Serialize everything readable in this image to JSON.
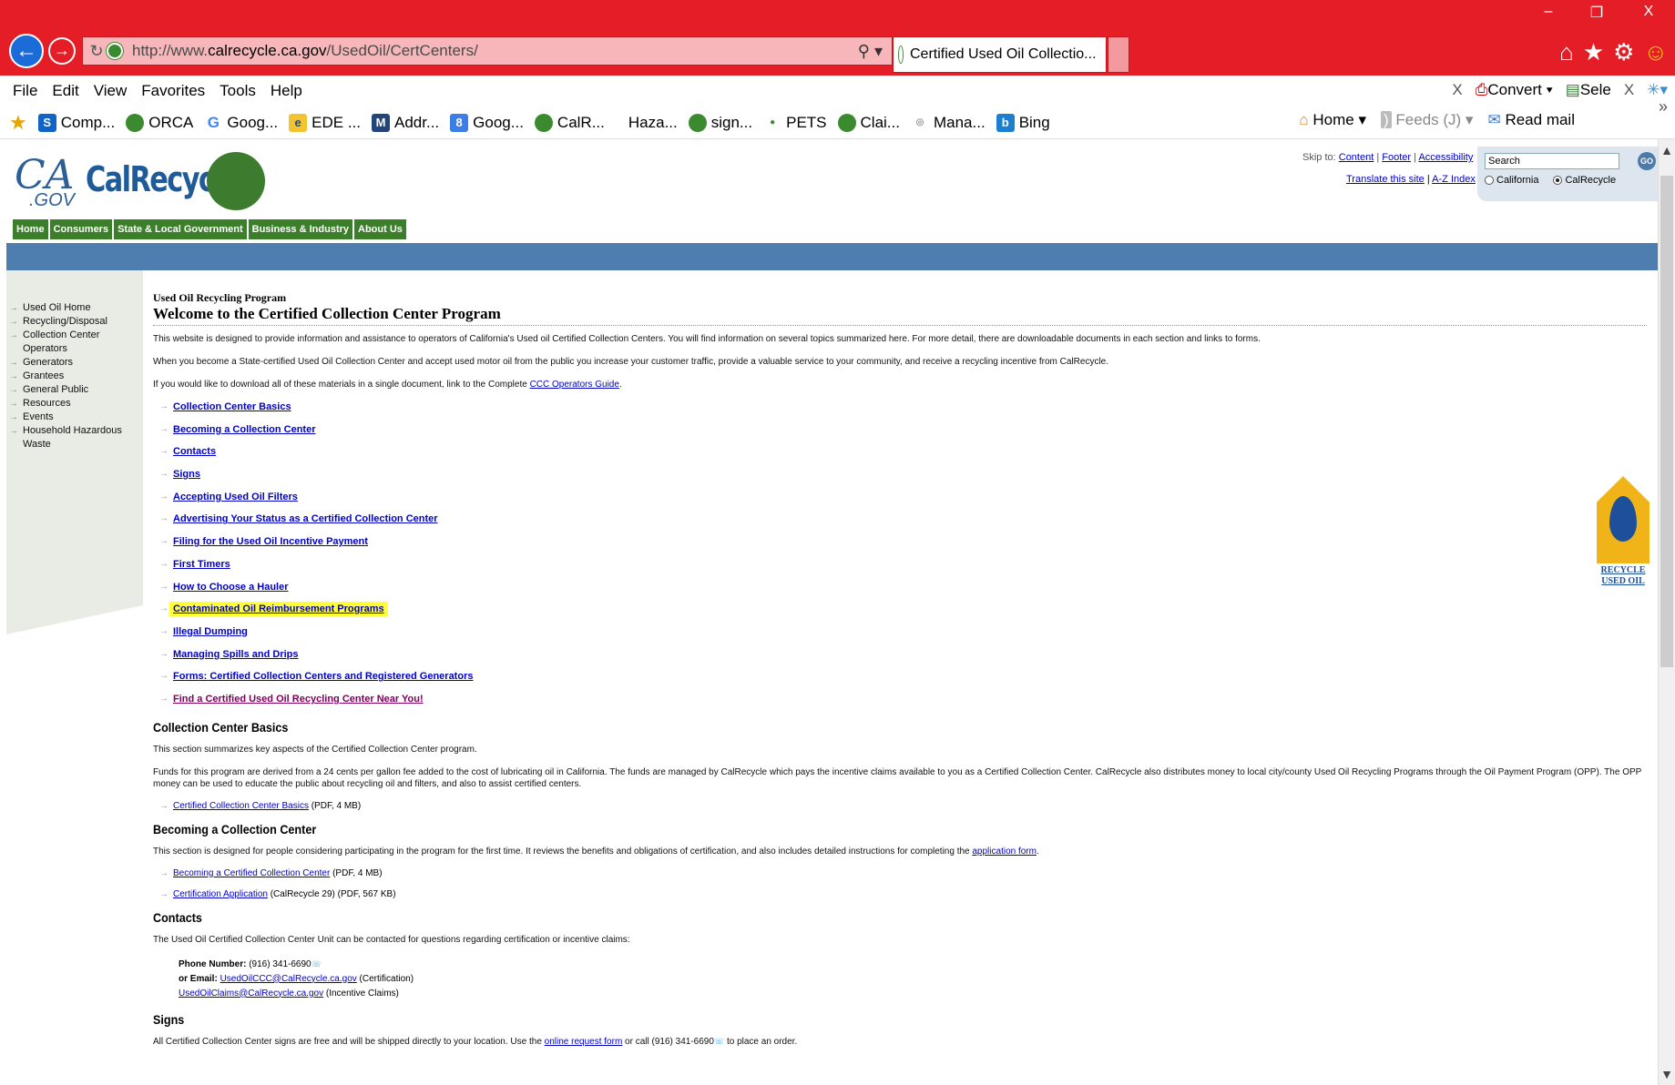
{
  "browser": {
    "window_controls": [
      "–",
      "❐",
      "X"
    ],
    "url_prefix": "http://www.",
    "url_domain": "calrecycle.ca.gov",
    "url_path": "/UsedOil/CertCenters/",
    "tab_title": "Certified Used Oil Collectio...",
    "tab_close": "×",
    "menu": [
      "File",
      "Edit",
      "View",
      "Favorites",
      "Tools",
      "Help"
    ],
    "menu_right": {
      "close": "X",
      "convert": "Convert",
      "select": "Sele",
      "close2": "X"
    },
    "favorites": [
      "Comp...",
      "ORCA",
      "Goog...",
      "EDE ...",
      "Addr...",
      "Goog...",
      "CalR...",
      "Haza...",
      "sign...",
      "PETS",
      "Clai...",
      "Mana...",
      "Bing"
    ],
    "fav_right": {
      "home": "Home",
      "feeds": "Feeds (J)",
      "read_mail": "Read mail"
    }
  },
  "header": {
    "logo_ca": "CA",
    "logo_gov": ".GOV",
    "logo_word": "CalRecycle",
    "topnav": [
      "Home",
      "Consumers",
      "State & Local Government",
      "Business & Industry",
      "About Us"
    ],
    "skip_to": "Skip to:",
    "skip_links": [
      "Content",
      "Footer",
      "Accessibility"
    ],
    "translate": "Translate this site",
    "az_index": "A-Z Index",
    "search_value": "Search",
    "go_label": "GO",
    "radio_california": "California",
    "radio_calrecycle": "CalRecycle"
  },
  "leftnav": [
    "Used Oil Home",
    "Recycling/Disposal",
    "Collection Center Operators",
    "Generators",
    "Grantees",
    "General Public",
    "Resources",
    "Events",
    "Household Hazardous Waste"
  ],
  "content": {
    "program_label": "Used Oil Recycling Program",
    "title": "Welcome to the Certified Collection Center Program",
    "intro1": "This website is designed to provide information and assistance to operators of California's Used oil Certified Collection Centers. You will find information on several topics summarized here. For more detail, there are downloadable documents in each section and links to forms.",
    "intro2": "When you become a State-certified Used Oil Collection Center and accept used motor oil from the public you increase your customer traffic, provide a valuable service to your community, and receive a recycling incentive from CalRecycle.",
    "intro3_pre": "If you would like to download all of these materials in a single document, link to the Complete ",
    "intro3_link": "CCC Operators Guide",
    "intro3_post": ".",
    "links": [
      "Collection Center Basics",
      "Becoming a Collection Center",
      "Contacts",
      "Signs",
      "Accepting Used Oil Filters",
      "Advertising Your Status as a Certified Collection Center",
      "Filing for the Used Oil Incentive Payment",
      "First Timers",
      "How to Choose a Hauler",
      "Contaminated Oil Reimbursement Programs",
      "Illegal Dumping",
      "Managing Spills and Drips",
      "Forms: Certified Collection Centers and Registered Generators",
      "Find a Certified Used Oil Recycling Center Near You!"
    ],
    "basics_h": "Collection Center Basics",
    "basics_p1": "This section summarizes key aspects of the Certified Collection Center program.",
    "basics_p2": "Funds for this program are derived from a 24 cents per gallon fee added to the cost of lubricating oil in California. The funds are managed by CalRecycle which pays the incentive claims available to you as a Certified Collection Center. CalRecycle also distributes money to local city/county Used Oil Recycling Programs through the Oil Payment Program (OPP). The OPP money can be used to educate the public about recycling oil and filters, and also to assist certified centers.",
    "basics_dl_link": "Certified Collection Center Basics",
    "basics_dl_meta": " (PDF, 4 MB)",
    "becoming_h": "Becoming a Collection Center",
    "becoming_p_pre": "This section is designed for people considering participating in the program for the first time. It reviews the benefits and obligations of certification, and also includes detailed instructions for completing the ",
    "becoming_p_link": "application form",
    "becoming_p_post": ".",
    "becoming_dl1_link": "Becoming a Certified Collection Center",
    "becoming_dl1_meta": " (PDF, 4 MB)",
    "becoming_dl2_link": "Certification Application",
    "becoming_dl2_meta": " (CalRecycle 29) (PDF, 567 KB)",
    "contacts_h": "Contacts",
    "contacts_p": "The Used Oil Certified Collection Center Unit can be contacted for questions regarding certification or incentive claims:",
    "phone_label": "Phone Number:",
    "phone_value": " (916) 341-6690",
    "email_label": "or Email:",
    "email1": "UsedOilCCC@CalRecycle.ca.gov",
    "email1_meta": " (Certification)",
    "email2": "UsedOilClaims@CalRecycle.ca.gov",
    "email2_meta": " (Incentive Claims)",
    "signs_h": "Signs",
    "signs_p_pre": "All Certified Collection Center signs are free and will be shipped directly to your location. Use the ",
    "signs_p_link": "online request form",
    "signs_p_mid": " or call (916) 341-6690",
    "signs_p_post": " to place an order."
  },
  "recycle_logo": {
    "line1": "RECYCLE",
    "line2": "USED OIL"
  }
}
